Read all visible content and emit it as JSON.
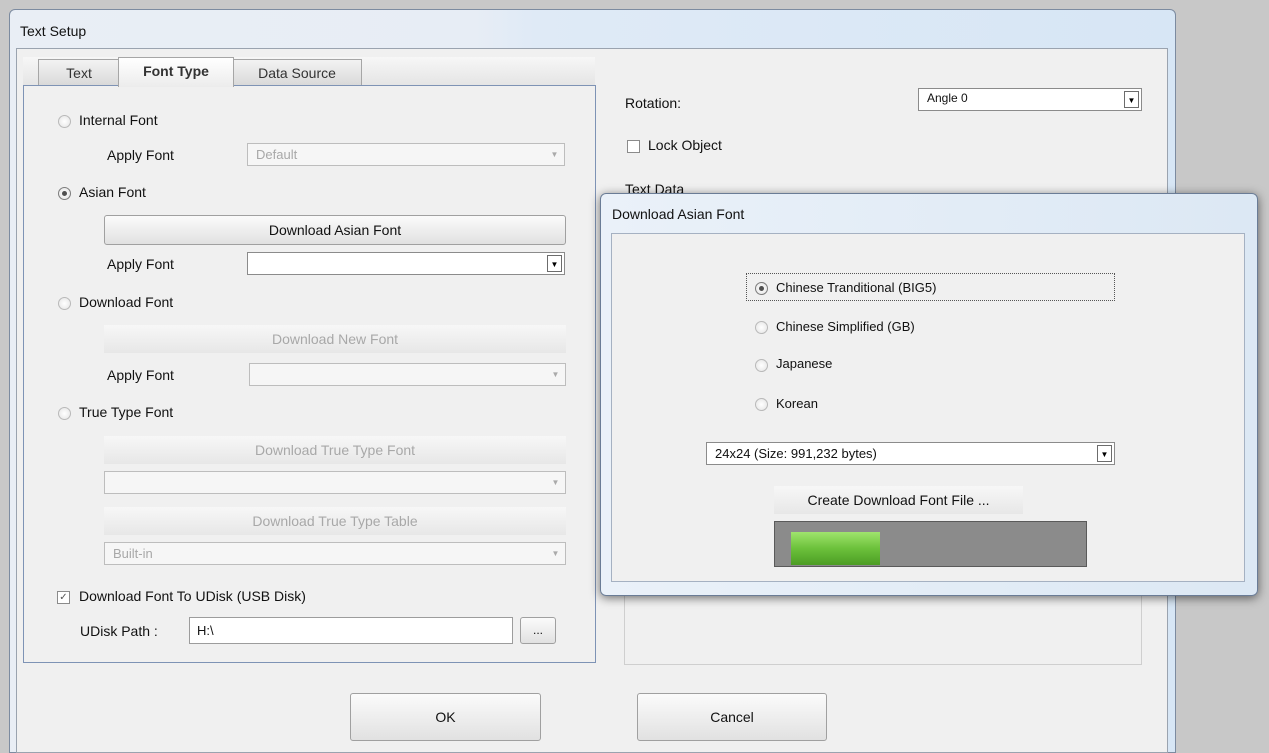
{
  "window": {
    "title": "Text Setup"
  },
  "tabs": [
    {
      "label": "Text",
      "active": false
    },
    {
      "label": "Font Type",
      "active": true
    },
    {
      "label": "Data Source",
      "active": false
    }
  ],
  "font_type": {
    "internal_font": {
      "label": "Internal Font",
      "selected": false,
      "apply_label": "Apply Font",
      "apply_value": "Default"
    },
    "asian_font": {
      "label": "Asian Font",
      "selected": true,
      "download_button": "Download Asian Font",
      "apply_label": "Apply Font",
      "apply_value": ""
    },
    "download_font": {
      "label": "Download Font",
      "selected": false,
      "download_button": "Download New Font",
      "apply_label": "Apply Font",
      "apply_value": ""
    },
    "true_type_font": {
      "label": "True Type Font",
      "selected": false,
      "download_button": "Download True Type Font",
      "font_value": "",
      "table_button": "Download True Type Table",
      "table_value": "Built-in"
    },
    "udisk": {
      "label": "Download Font To UDisk (USB Disk)",
      "checked": true,
      "path_label": "UDisk Path :",
      "path_value": "H:\\",
      "browse_label": "..."
    }
  },
  "right_panel": {
    "rotation_label": "Rotation:",
    "rotation_value": "Angle 0",
    "lock_object_label": "Lock Object",
    "text_data_label": "Text Data"
  },
  "buttons": {
    "ok": "OK",
    "cancel": "Cancel"
  },
  "dialog": {
    "title": "Download Asian Font",
    "options": [
      {
        "label": "Chinese Tranditional (BIG5)",
        "selected": true
      },
      {
        "label": "Chinese Simplified (GB)",
        "selected": false
      },
      {
        "label": "Japanese",
        "selected": false
      },
      {
        "label": "Korean",
        "selected": false
      }
    ],
    "size_value": "24x24 (Size: 991,232 bytes)",
    "create_label": "Create Download Font File ...",
    "progress": 0.3
  },
  "icons": {
    "combo_arrow": "chevron-down-icon",
    "checkmark": "check-icon"
  },
  "colors": {
    "progress_fill": "#6cc13b",
    "progress_track": "#8b8b8b",
    "panel_border": "#7e93b5"
  }
}
